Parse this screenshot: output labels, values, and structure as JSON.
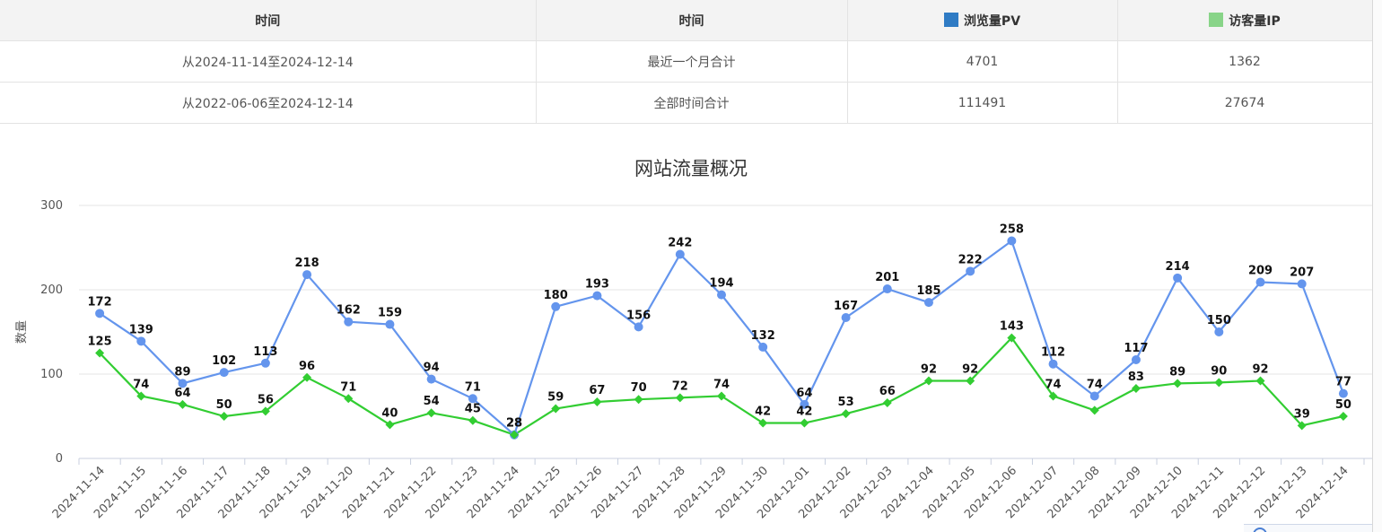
{
  "table": {
    "headers": {
      "col1": "时间",
      "col2": "时间",
      "col3": "浏览量PV",
      "col4": "访客量IP"
    },
    "rows": [
      {
        "range": "从2024-11-14至2024-12-14",
        "label": "最近一个月合计",
        "pv": "4701",
        "ip": "1362"
      },
      {
        "range": "从2022-06-06至2024-12-14",
        "label": "全部时间合计",
        "pv": "111491",
        "ip": "27674"
      }
    ]
  },
  "colors": {
    "pv": "#6495ED",
    "ip": "#32CD32",
    "pv_swatch": "#2f7bc4",
    "ip_swatch": "#88d488"
  },
  "chart_data": {
    "type": "line",
    "title": "网站流量概况",
    "ylabel": "数量",
    "xlabel": "",
    "ylim": [
      0,
      300
    ],
    "yticks": [
      0,
      100,
      200,
      300
    ],
    "grid": true,
    "categories": [
      "2024-11-14",
      "2024-11-15",
      "2024-11-16",
      "2024-11-17",
      "2024-11-18",
      "2024-11-19",
      "2024-11-20",
      "2024-11-21",
      "2024-11-22",
      "2024-11-23",
      "2024-11-24",
      "2024-11-25",
      "2024-11-26",
      "2024-11-27",
      "2024-11-28",
      "2024-11-29",
      "2024-11-30",
      "2024-12-01",
      "2024-12-02",
      "2024-12-03",
      "2024-12-04",
      "2024-12-05",
      "2024-12-06",
      "2024-12-07",
      "2024-12-08",
      "2024-12-09",
      "2024-12-10",
      "2024-12-11",
      "2024-12-12",
      "2024-12-13",
      "2024-12-14"
    ],
    "series": [
      {
        "name": "浏览量PV",
        "marker": "circle",
        "values": [
          172,
          139,
          89,
          102,
          113,
          218,
          162,
          159,
          94,
          71,
          28,
          180,
          193,
          156,
          242,
          194,
          132,
          64,
          167,
          201,
          185,
          222,
          258,
          112,
          74,
          117,
          214,
          150,
          209,
          207,
          77
        ]
      },
      {
        "name": "访客量IP",
        "marker": "diamond",
        "values": [
          125,
          74,
          64,
          50,
          56,
          96,
          71,
          40,
          54,
          45,
          28,
          59,
          67,
          70,
          72,
          74,
          42,
          42,
          53,
          66,
          92,
          92,
          143,
          74,
          57,
          83,
          89,
          90,
          92,
          39,
          50
        ]
      }
    ],
    "visible_labels": {
      "ip_hidden_index": [
        24
      ]
    }
  }
}
